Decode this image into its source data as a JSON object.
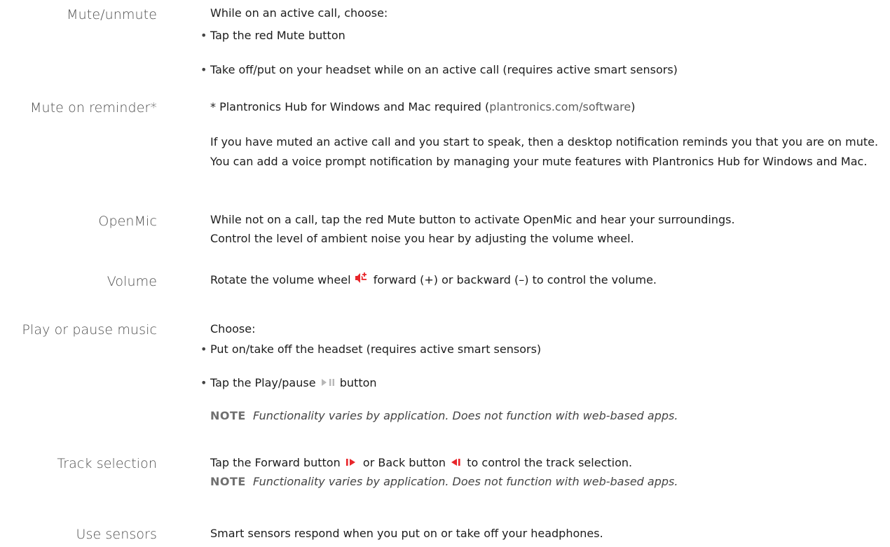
{
  "colors": {
    "accent": "#e8262b",
    "muted_icon": "#b7b7b7"
  },
  "mute": {
    "label": "Mute/unmute",
    "intro": "While on an active call, choose:",
    "bullet1": "Tap the red Mute button",
    "bullet2": "Take off/put on your headset while on an active call (requires active smart sensors)"
  },
  "mute_reminder": {
    "label": "Mute on reminder*",
    "req_prefix": "* Plantronics Hub for Windows and Mac required (",
    "req_link": "plantronics.com/software",
    "req_suffix": ")",
    "body": "If you have muted an active call and you start to speak, then a desktop notification reminds you that you are on mute. You can add a voice prompt notification by managing your mute features with Plantronics Hub for Windows and Mac."
  },
  "openmic": {
    "label": "OpenMic",
    "line1": "While not on a call, tap the red Mute button to activate OpenMic and hear your surroundings.",
    "line2": "Control the level of ambient noise you hear by adjusting the volume wheel."
  },
  "volume": {
    "label": "Volume",
    "pre": "Rotate the volume wheel",
    "icon": "volume-wheel-icon",
    "post": "forward (+) or backward (–) to control the volume."
  },
  "music": {
    "label": "Play or pause music",
    "intro": "Choose:",
    "bullet1": "Put on/take off the headset (requires active smart sensors)",
    "bullet2_pre": "Tap the Play/pause",
    "bullet2_icon": "play-pause-icon",
    "bullet2_post": "button",
    "note_kw": "NOTE",
    "note": "Functionality varies by application. Does not function with web-based apps."
  },
  "track": {
    "label": "Track selection",
    "pre": "Tap the Forward button",
    "forward_icon": "forward-icon",
    "mid": "or Back button",
    "back_icon": "back-icon",
    "post": "to control the track selection.",
    "note_kw": "NOTE",
    "note": "Functionality varies by application. Does not function with web-based apps."
  },
  "sensors": {
    "label": "Use sensors",
    "text": "Smart sensors respond when you put on or take off your headphones."
  }
}
